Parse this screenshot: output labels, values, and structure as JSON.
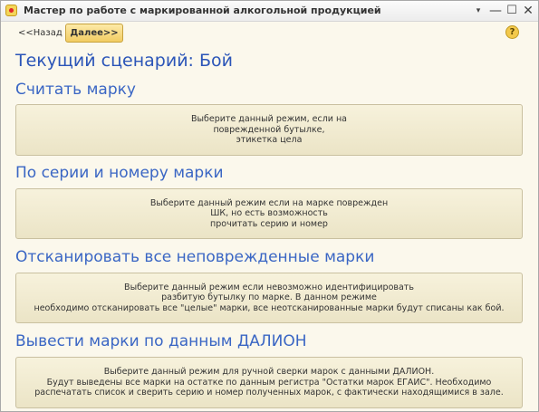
{
  "window": {
    "title": "Мастер по работе с маркированной алкогольной продукцией",
    "controls": {
      "menu": "▾",
      "minimize": "—",
      "maximize": "☐",
      "close": "✕"
    }
  },
  "toolbar": {
    "back_label": "<<Назад",
    "next_label": "Далее>>",
    "help_label": "?"
  },
  "scenario_title": "Текущий сценарий: Бой",
  "sections": [
    {
      "heading": "Считать марку",
      "lines": [
        "Выберите данный режим, если на",
        "поврежденной бутылке,",
        "этикетка цела"
      ]
    },
    {
      "heading": "По серии и номеру марки",
      "lines": [
        "Выберите данный режим если на марке поврежден",
        "ШК, но есть возможность",
        "прочитать серию и номер"
      ]
    },
    {
      "heading": "Отсканировать все неповрежденные марки",
      "lines": [
        "Выберите данный режим если невозможно идентифицировать",
        "разбитую бутылку по марке. В данном режиме",
        "необходимо отсканировать все \"целые\" марки, все неотсканированные марки будут списаны как бой."
      ]
    },
    {
      "heading": "Вывести марки по данным ДАЛИОН",
      "lines": [
        "Выберите данный режим для ручной сверки марок с данными ДАЛИОН.",
        "Будут выведены все марки на остатке по данным регистра \"Остатки марок ЕГАИС\". Необходимо",
        "распечатать список и сверить серию и номер полученных марок, с фактически находящимися в зале."
      ]
    }
  ],
  "colors": {
    "background": "#fbf8ec",
    "heading": "#3a66c4",
    "next_button": "#f2cc62"
  }
}
